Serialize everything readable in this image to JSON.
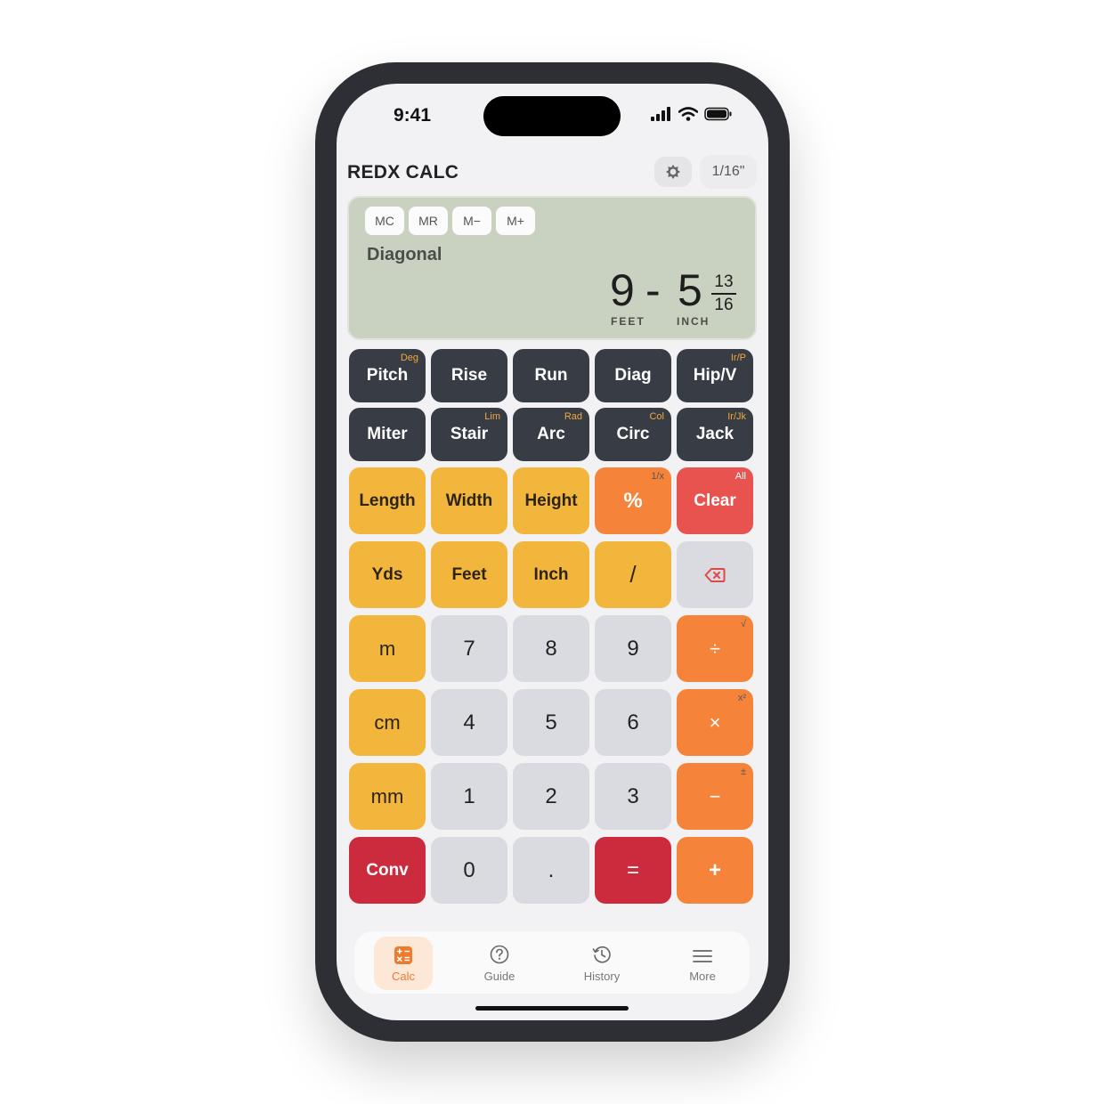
{
  "status": {
    "time": "9:41"
  },
  "header": {
    "title": "REDX CALC",
    "theme_icon": "theme-toggle-icon",
    "precision": "1/16\""
  },
  "memory": [
    "MC",
    "MR",
    "M−",
    "M+"
  ],
  "display": {
    "mode": "Diagonal",
    "feet": "9",
    "separator": "-",
    "inches": "5",
    "frac_num": "13",
    "frac_den": "16",
    "feet_unit": "FEET",
    "inch_unit": "INCH"
  },
  "keys": {
    "pitch": "Pitch",
    "pitch_sub": "Deg",
    "rise": "Rise",
    "run": "Run",
    "diag": "Diag",
    "hipv": "Hip/V",
    "hipv_sub": "Ir/P",
    "miter": "Miter",
    "stair": "Stair",
    "stair_sub": "Lim",
    "arc": "Arc",
    "arc_sub": "Rad",
    "circ": "Circ",
    "circ_sub": "Col",
    "jack": "Jack",
    "jack_sub": "Ir/Jk",
    "length": "Length",
    "width": "Width",
    "height": "Height",
    "percent": "%",
    "percent_sub": "1/x",
    "clear": "Clear",
    "clear_sub": "All",
    "yds": "Yds",
    "feet": "Feet",
    "inch": "Inch",
    "slash": "/",
    "m": "m",
    "d7": "7",
    "d8": "8",
    "d9": "9",
    "divide": "÷",
    "divide_sub": "√",
    "cm": "cm",
    "d4": "4",
    "d5": "5",
    "d6": "6",
    "multiply": "×",
    "multiply_sub": "x²",
    "mm": "mm",
    "d1": "1",
    "d2": "2",
    "d3": "3",
    "minus": "−",
    "minus_sub": "±",
    "conv": "Conv",
    "d0": "0",
    "dot": ".",
    "equals": "=",
    "plus": "+"
  },
  "tabs": [
    {
      "label": "Calc",
      "icon": "calculator-icon"
    },
    {
      "label": "Guide",
      "icon": "question-icon"
    },
    {
      "label": "History",
      "icon": "history-icon"
    },
    {
      "label": "More",
      "icon": "menu-icon"
    }
  ],
  "colors": {
    "dark_key": "#383c44",
    "yellow_key": "#f2b63d",
    "gray_key": "#d9dbe0",
    "orange_key": "#f5843a",
    "red_key": "#e8524f",
    "crimson_key": "#cc2b3e",
    "display_bg": "#c9d2c0",
    "accent": "#ee7a2e"
  }
}
